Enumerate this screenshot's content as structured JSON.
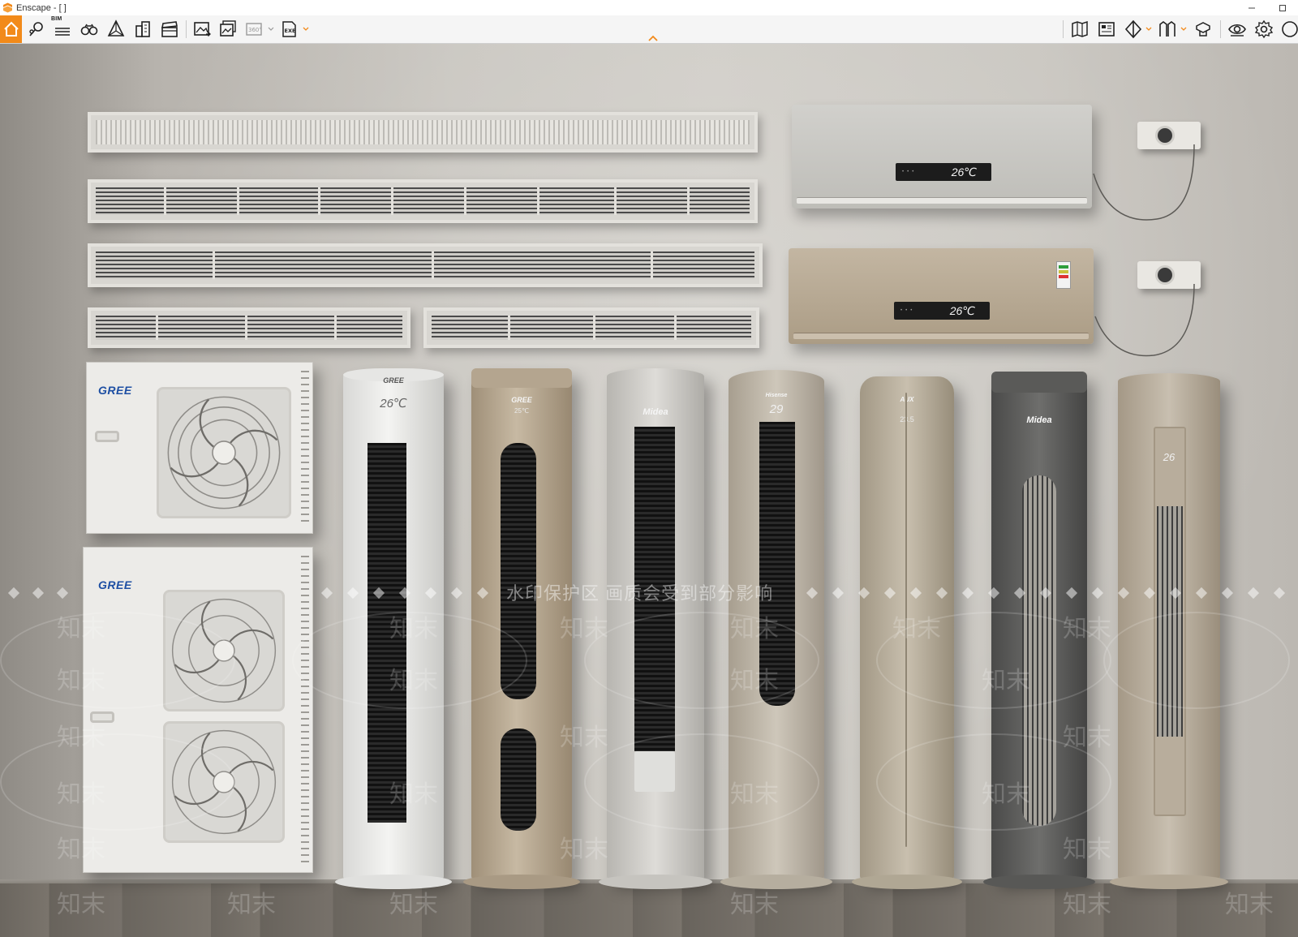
{
  "window": {
    "title": "Enscape - [ ]",
    "controls": [
      "minimize",
      "maximize"
    ]
  },
  "toolbar": {
    "bim_label": "BIM",
    "left_icons": [
      "home-icon",
      "pin-icon",
      "bim-list-icon",
      "binoculars-icon",
      "cube-perspective-icon",
      "buildings-icon",
      "clapperboard-icon",
      "render-image-icon",
      "batch-render-icon",
      "panorama-360-icon",
      "export-exe-icon"
    ],
    "right_icons": [
      "map-icon",
      "book-icon",
      "section-icon",
      "views-icon",
      "asset-library-icon",
      "visibility-icon",
      "settings-icon",
      "help-icon"
    ],
    "accent_color": "#f28a1a"
  },
  "scene": {
    "wall_units": [
      {
        "display_temp": "26℃",
        "color": "#c9c7c2"
      },
      {
        "display_temp": "26℃",
        "color": "#b7aa96"
      }
    ],
    "outdoor_units": [
      {
        "brand": "GREE"
      },
      {
        "brand": "GREE"
      }
    ],
    "tower_units": [
      {
        "brand": "GREE",
        "temp": "26℃",
        "sub": ""
      },
      {
        "brand": "GREE",
        "temp": "",
        "sub": "25℃"
      },
      {
        "brand": "Midea",
        "temp": "",
        "sub": ""
      },
      {
        "brand": "Hisense",
        "temp": "29",
        "sub": ""
      },
      {
        "brand": "AUX",
        "temp": "",
        "sub": "23.5"
      },
      {
        "brand": "Midea",
        "temp": "",
        "sub": ""
      },
      {
        "brand": "",
        "temp": "26",
        "sub": ""
      }
    ],
    "watermark": {
      "text": "水印保护区  画质会受到部分影响",
      "mark": "知末"
    }
  }
}
